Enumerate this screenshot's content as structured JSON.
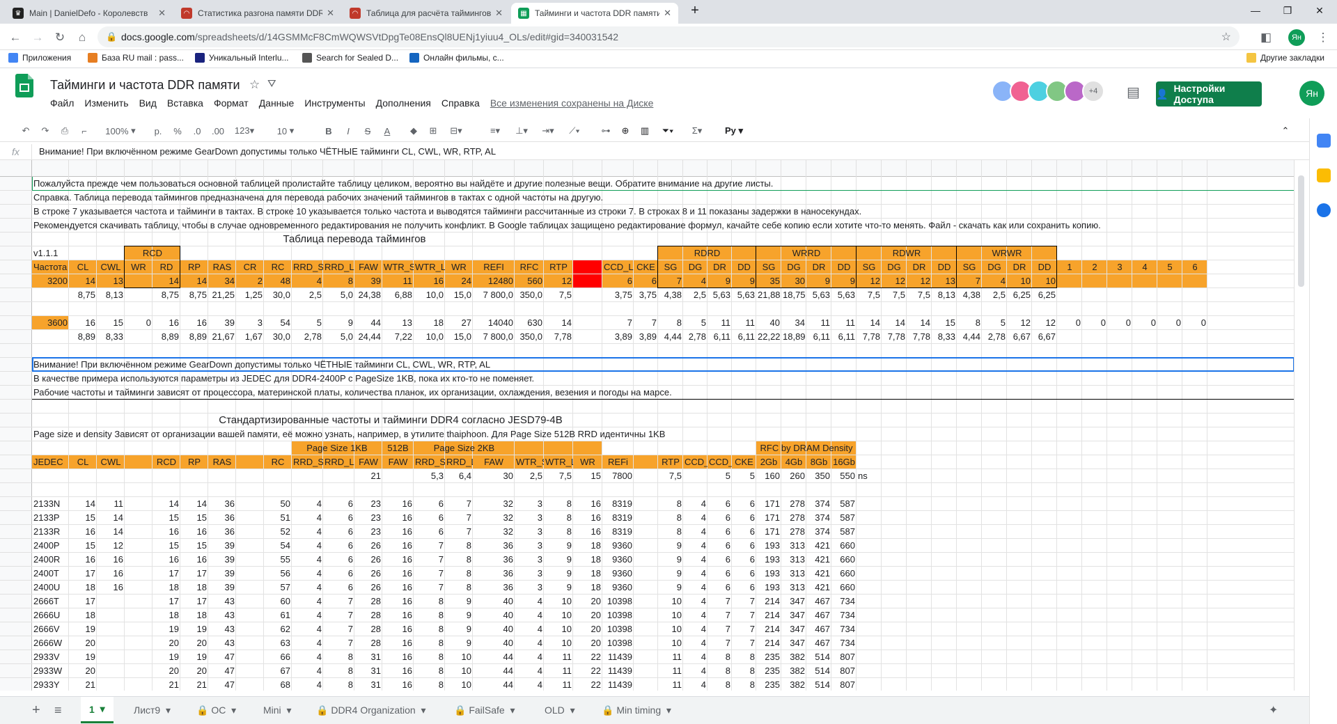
{
  "browser": {
    "tabs": [
      {
        "title": "Main | DanielDefo - Королевств",
        "color": "#222222"
      },
      {
        "title": "Статистика разгона памяти DDR",
        "color": "#c0392b"
      },
      {
        "title": "Таблица для расчёта таймингов",
        "color": "#c0392b"
      },
      {
        "title": "Тайминги и частота DDR памяти",
        "color": "#0f9d58"
      }
    ],
    "url_host": "docs.google.com",
    "url_path": "/spreadsheets/d/14GSMMcF8CmWQWSVtDpgTe08EnsQl8UENj1yiuu4_OLs/edit#gid=340031542",
    "bookmarks": [
      "Приложения",
      "База RU mail : pass...",
      "Уникальный Interlu...",
      "Search for Sealed D...",
      "Онлайн фильмы, с..."
    ],
    "other_bookmarks": "Другие закладки",
    "profile": "Ян"
  },
  "sheets": {
    "title": "Тайминги и частота DDR памяти",
    "menu": [
      "Файл",
      "Изменить",
      "Вид",
      "Вставка",
      "Формат",
      "Данные",
      "Инструменты",
      "Дополнения",
      "Справка"
    ],
    "saved_status": "Все изменения сохранены на Диске",
    "collab_more": "+4",
    "share_label": "Настройки Доступа",
    "user_initials": "Ян",
    "zoom": "100%",
    "font_size": "10",
    "formula_value": "Внимание! При включённом режиме GearDown допустимы только ЧЁТНЫЕ тайминги CL, CWL, WR, RTP, AL",
    "accent_green": "#0f9d58",
    "header_orange": "#f7a32b"
  },
  "columns": [
    "A",
    "B",
    "C",
    "D",
    "E",
    "F",
    "G",
    "H",
    "I",
    "J",
    "K",
    "L",
    "M",
    "N",
    "O",
    "P",
    "Q",
    "R",
    "S",
    "T",
    "U",
    "V",
    "W",
    "X",
    "Y",
    "Z",
    "AA",
    "AB",
    "AC",
    "AD",
    "AE",
    "AF",
    "AG",
    "AH",
    "AI",
    "AJ",
    "AK",
    "AL",
    "AM",
    "AN",
    "AO",
    "AP",
    "AQ"
  ],
  "rows": [
    "1",
    "2",
    "3",
    "4",
    "5",
    "6",
    "7",
    "8",
    "9",
    "10",
    "11",
    "12",
    "13",
    "14",
    "15",
    "16",
    "17",
    "18",
    "19",
    "20",
    "21",
    "22",
    "23",
    "24",
    "25",
    "26",
    "27",
    "28",
    "29",
    "30",
    "31",
    "32",
    "33",
    "34",
    "35",
    "36",
    "37"
  ],
  "notes": {
    "r1": "Пожалуйста прежде чем пользоваться основной таблицей пролистайте таблицу целиком, вероятно вы найдёте и другие полезные вещи. Обратите внимание на другие листы.",
    "r2": "Справка. Таблица перевода таймингов предназначена для перевода рабочих значений таймингов в тактах с одной частоты на другую.",
    "r3": "В строке 7 указывается частота и тайминги в тактах. В строке 10 указывается только частота и выводятся тайминги рассчитанные из строки 7. В строках 8 и 11 показаны задержки в наносекундах.",
    "r4": "Рекомендуется скачивать таблицу, чтобы в случае одновременного редактирования не получить конфликт. В Google таблицах защищено редактирование формул, качайте себе копию если хотите что-то менять. Файл - скачать как или сохранить копию.",
    "r14": "Внимание! При включённом режиме GearDown допустимы только ЧЁТНЫЕ тайминги CL, CWL, WR, RTP, AL",
    "r15": "В качестве примера используются параметры из JEDEC для DDR4-2400P с PageSize 1KB, пока их кто-то не поменяет.",
    "r16": "Рабочие частоты и тайминги зависят от процессора, материнской платы, количества планок, их организации, охлаждения, везения и погоды на марсе.",
    "r19": "Page size и density Зависят от организации вашей памяти, её можно узнать, например, в утилите thaiphoon. Для Page Size 512B RRD идентичны 1KB"
  },
  "top_table": {
    "title": "Таблица перевода таймингов",
    "version": "v1.1.1",
    "groups": {
      "rcd": "RCD",
      "rdrd": "RDRD",
      "wrrd": "WRRD",
      "rdwr": "RDWR",
      "wrwr": "WRWR"
    },
    "headers": [
      "Частота",
      "CL",
      "CWL",
      "WR",
      "RD",
      "RP",
      "RAS",
      "CR",
      "RC",
      "RRD_S",
      "RRD_L",
      "FAW",
      "WTR_S",
      "WTR_L",
      "WR",
      "REFI",
      "RFC",
      "RTP",
      "",
      "CCD_L",
      "CKE",
      "SG",
      "DG",
      "DR",
      "DD",
      "SG",
      "DG",
      "DR",
      "DD",
      "SG",
      "DG",
      "DR",
      "DD",
      "SG",
      "DG",
      "DR",
      "DD",
      "1",
      "2",
      "3",
      "4",
      "5",
      "6"
    ],
    "row8": [
      "3200",
      "14",
      "13",
      "",
      "14",
      "14",
      "34",
      "2",
      "48",
      "4",
      "8",
      "39",
      "11",
      "16",
      "24",
      "12480",
      "560",
      "12",
      "",
      "6",
      "6",
      "7",
      "4",
      "9",
      "9",
      "35",
      "30",
      "9",
      "9",
      "12",
      "12",
      "12",
      "13",
      "7",
      "4",
      "10",
      "10",
      "",
      "",
      "",
      "",
      "",
      ""
    ],
    "row9": [
      "",
      "8,75",
      "8,13",
      "",
      "8,75",
      "8,75",
      "21,25",
      "1,25",
      "30,0",
      "2,5",
      "5,0",
      "24,38",
      "6,88",
      "10,0",
      "15,0",
      "7 800,0",
      "350,0",
      "7,5",
      "",
      "3,75",
      "3,75",
      "4,38",
      "2,5",
      "5,63",
      "5,63",
      "21,88",
      "18,75",
      "5,63",
      "5,63",
      "7,5",
      "7,5",
      "7,5",
      "8,13",
      "4,38",
      "2,5",
      "6,25",
      "6,25",
      "",
      "",
      "",
      "",
      "",
      ""
    ],
    "row11": [
      "3600",
      "16",
      "15",
      "0",
      "16",
      "16",
      "39",
      "3",
      "54",
      "5",
      "9",
      "44",
      "13",
      "18",
      "27",
      "14040",
      "630",
      "14",
      "",
      "7",
      "7",
      "8",
      "5",
      "11",
      "11",
      "40",
      "34",
      "11",
      "11",
      "14",
      "14",
      "14",
      "15",
      "8",
      "5",
      "12",
      "12",
      "0",
      "0",
      "0",
      "0",
      "0",
      "0"
    ],
    "row12": [
      "",
      "8,89",
      "8,33",
      "",
      "8,89",
      "8,89",
      "21,67",
      "1,67",
      "30,0",
      "2,78",
      "5,0",
      "24,44",
      "7,22",
      "10,0",
      "15,0",
      "7 800,0",
      "350,0",
      "7,78",
      "",
      "3,89",
      "3,89",
      "4,44",
      "2,78",
      "6,11",
      "6,11",
      "22,22",
      "18,89",
      "6,11",
      "6,11",
      "7,78",
      "7,78",
      "7,78",
      "8,33",
      "4,44",
      "2,78",
      "6,67",
      "6,67",
      "",
      "",
      "",
      "",
      "",
      ""
    ]
  },
  "jedec": {
    "title": "Стандартизированные частоты и тайминги DDR4 согласно JESD79-4B",
    "groups": {
      "page1k": "Page Size 1KB",
      "page512": "512B",
      "page2k": "Page Size 2KB",
      "rfc": "RFC by DRAM Density"
    },
    "headers": [
      "JEDEC",
      "CL",
      "CWL",
      "",
      "RCD",
      "RP",
      "RAS",
      "",
      "RC",
      "RRD_S",
      "RRD_L",
      "FAW",
      "FAW",
      "RRD_S",
      "RRD_L",
      "FAW",
      "WTR_S",
      "WTR_L",
      "WR",
      "REFi",
      "",
      "RTP",
      "CCD_S",
      "CCD_L",
      "CKE",
      "2Gb",
      "4Gb",
      "8Gb",
      "16Gb"
    ],
    "row22": [
      "",
      "",
      "",
      "",
      "",
      "",
      "",
      "",
      "",
      "",
      "",
      "21",
      "",
      "5,3",
      "6,4",
      "30",
      "2,5",
      "7,5",
      "15",
      "7800",
      "",
      "7,5",
      "",
      "5",
      "5",
      "160",
      "260",
      "350",
      "550"
    ],
    "ns_label": "ns",
    "rows": [
      {
        "row": "24",
        "v": [
          "2133N",
          "14",
          "11",
          "",
          "14",
          "14",
          "36",
          "",
          "50",
          "4",
          "6",
          "23",
          "16",
          "6",
          "7",
          "32",
          "3",
          "8",
          "16",
          "8319",
          "",
          "8",
          "4",
          "6",
          "6",
          "171",
          "278",
          "374",
          "587"
        ]
      },
      {
        "row": "25",
        "v": [
          "2133P",
          "15",
          "14",
          "",
          "15",
          "15",
          "36",
          "",
          "51",
          "4",
          "6",
          "23",
          "16",
          "6",
          "7",
          "32",
          "3",
          "8",
          "16",
          "8319",
          "",
          "8",
          "4",
          "6",
          "6",
          "171",
          "278",
          "374",
          "587"
        ]
      },
      {
        "row": "26",
        "v": [
          "2133R",
          "16",
          "14",
          "",
          "16",
          "16",
          "36",
          "",
          "52",
          "4",
          "6",
          "23",
          "16",
          "6",
          "7",
          "32",
          "3",
          "8",
          "16",
          "8319",
          "",
          "8",
          "4",
          "6",
          "6",
          "171",
          "278",
          "374",
          "587"
        ]
      },
      {
        "row": "27",
        "v": [
          "2400P",
          "15",
          "12",
          "",
          "15",
          "15",
          "39",
          "",
          "54",
          "4",
          "6",
          "26",
          "16",
          "7",
          "8",
          "36",
          "3",
          "9",
          "18",
          "9360",
          "",
          "9",
          "4",
          "6",
          "6",
          "193",
          "313",
          "421",
          "660"
        ]
      },
      {
        "row": "28",
        "v": [
          "2400R",
          "16",
          "16",
          "",
          "16",
          "16",
          "39",
          "",
          "55",
          "4",
          "6",
          "26",
          "16",
          "7",
          "8",
          "36",
          "3",
          "9",
          "18",
          "9360",
          "",
          "9",
          "4",
          "6",
          "6",
          "193",
          "313",
          "421",
          "660"
        ]
      },
      {
        "row": "29",
        "v": [
          "2400T",
          "17",
          "16",
          "",
          "17",
          "17",
          "39",
          "",
          "56",
          "4",
          "6",
          "26",
          "16",
          "7",
          "8",
          "36",
          "3",
          "9",
          "18",
          "9360",
          "",
          "9",
          "4",
          "6",
          "6",
          "193",
          "313",
          "421",
          "660"
        ]
      },
      {
        "row": "30",
        "v": [
          "2400U",
          "18",
          "16",
          "",
          "18",
          "18",
          "39",
          "",
          "57",
          "4",
          "6",
          "26",
          "16",
          "7",
          "8",
          "36",
          "3",
          "9",
          "18",
          "9360",
          "",
          "9",
          "4",
          "6",
          "6",
          "193",
          "313",
          "421",
          "660"
        ]
      },
      {
        "row": "31",
        "v": [
          "2666T",
          "17",
          "",
          "",
          "17",
          "17",
          "43",
          "",
          "60",
          "4",
          "7",
          "28",
          "16",
          "8",
          "9",
          "40",
          "4",
          "10",
          "20",
          "10398",
          "",
          "10",
          "4",
          "7",
          "7",
          "214",
          "347",
          "467",
          "734"
        ]
      },
      {
        "row": "32",
        "v": [
          "2666U",
          "18",
          "",
          "",
          "18",
          "18",
          "43",
          "",
          "61",
          "4",
          "7",
          "28",
          "16",
          "8",
          "9",
          "40",
          "4",
          "10",
          "20",
          "10398",
          "",
          "10",
          "4",
          "7",
          "7",
          "214",
          "347",
          "467",
          "734"
        ]
      },
      {
        "row": "33",
        "v": [
          "2666V",
          "19",
          "",
          "",
          "19",
          "19",
          "43",
          "",
          "62",
          "4",
          "7",
          "28",
          "16",
          "8",
          "9",
          "40",
          "4",
          "10",
          "20",
          "10398",
          "",
          "10",
          "4",
          "7",
          "7",
          "214",
          "347",
          "467",
          "734"
        ]
      },
      {
        "row": "34",
        "v": [
          "2666W",
          "20",
          "",
          "",
          "20",
          "20",
          "43",
          "",
          "63",
          "4",
          "7",
          "28",
          "16",
          "8",
          "9",
          "40",
          "4",
          "10",
          "20",
          "10398",
          "",
          "10",
          "4",
          "7",
          "7",
          "214",
          "347",
          "467",
          "734"
        ]
      },
      {
        "row": "35",
        "v": [
          "2933V",
          "19",
          "",
          "",
          "19",
          "19",
          "47",
          "",
          "66",
          "4",
          "8",
          "31",
          "16",
          "8",
          "10",
          "44",
          "4",
          "11",
          "22",
          "11439",
          "",
          "11",
          "4",
          "8",
          "8",
          "235",
          "382",
          "514",
          "807"
        ]
      },
      {
        "row": "36",
        "v": [
          "2933W",
          "20",
          "",
          "",
          "20",
          "20",
          "47",
          "",
          "67",
          "4",
          "8",
          "31",
          "16",
          "8",
          "10",
          "44",
          "4",
          "11",
          "22",
          "11439",
          "",
          "11",
          "4",
          "8",
          "8",
          "235",
          "382",
          "514",
          "807"
        ]
      },
      {
        "row": "37",
        "v": [
          "2933Y",
          "21",
          "",
          "",
          "21",
          "21",
          "47",
          "",
          "68",
          "4",
          "8",
          "31",
          "16",
          "8",
          "10",
          "44",
          "4",
          "11",
          "22",
          "11439",
          "",
          "11",
          "4",
          "8",
          "8",
          "235",
          "382",
          "514",
          "807"
        ]
      }
    ]
  },
  "tabs": [
    "1",
    "Лист9",
    "OC",
    "Mini",
    "DDR4 Organization",
    "FailSafe",
    "OLD",
    "Min timing"
  ]
}
